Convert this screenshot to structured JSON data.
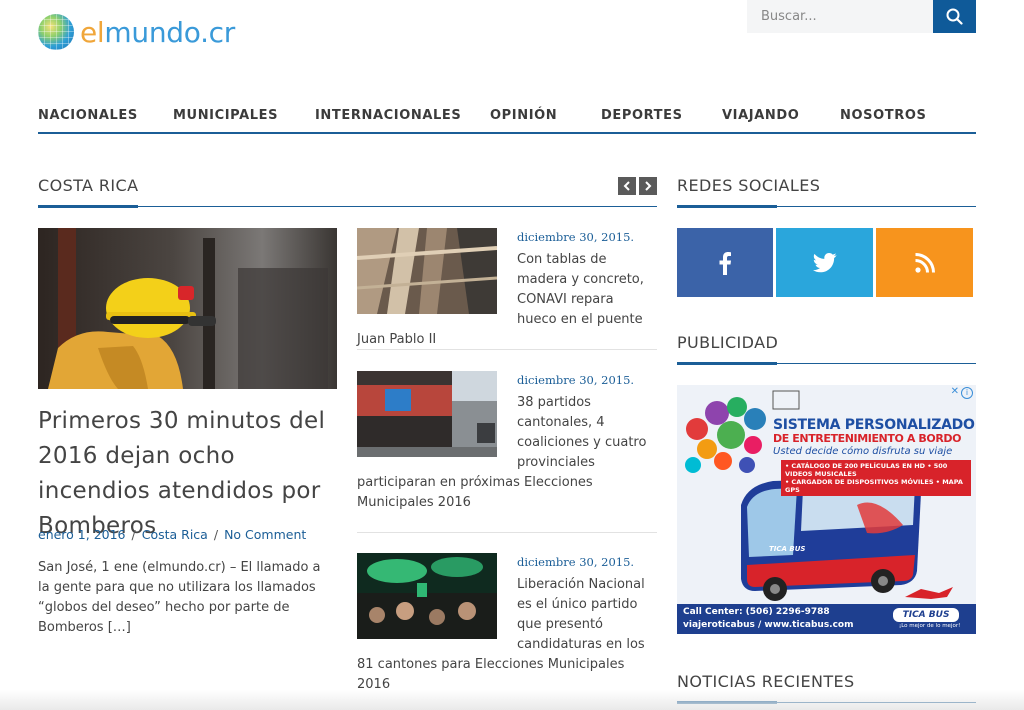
{
  "site": {
    "logo_el": "el",
    "logo_rest": "mundo.cr"
  },
  "search": {
    "placeholder": "Buscar..."
  },
  "nav": {
    "items": [
      "NACIONALES",
      "MUNICIPALES",
      "INTERNACIONALES",
      "OPINIÓN",
      "DEPORTES",
      "VIAJANDO",
      "NOSOTROS"
    ]
  },
  "main": {
    "section_title": "COSTA RICA",
    "featured": {
      "title": "Primeros 30 minutos del 2016 dejan ocho incendios atendidos por Bomberos",
      "date": "enero 1, 2016",
      "category": "Costa Rica",
      "comments": "No Comment",
      "separator": "/",
      "excerpt": "San José, 1 ene (elmundo.cr) – El llamado a la gente para que no utilizara los llamados “globos del deseo” hecho por parte de Bomberos […]"
    },
    "side_articles": [
      {
        "date": "diciembre 30, 2015.",
        "title": "Con tablas de madera y concreto, CONAVI repara hueco en el puente Juan Pablo II"
      },
      {
        "date": "diciembre 30, 2015.",
        "title": "38 partidos cantonales, 4 coaliciones y cuatro provinciales participaran en próximas Elecciones Municipales 2016"
      },
      {
        "date": "diciembre 30, 2015.",
        "title": "Liberación Nacional es el único partido que presentó candidaturas en los 81 cantones para Elecciones Municipales 2016"
      }
    ]
  },
  "sidebar": {
    "social_title": "REDES SOCIALES",
    "ads_title": "PUBLICIDAD",
    "recent_title": "NOTICIAS RECIENTES",
    "social": [
      {
        "name": "facebook",
        "color": "#3b63a8"
      },
      {
        "name": "twitter",
        "color": "#2aa6dc"
      },
      {
        "name": "rss",
        "color": "#f7941d"
      }
    ]
  },
  "ad": {
    "title1": "SISTEMA PERSONALIZADO",
    "title2": "DE ENTRETENIMIENTO A BORDO",
    "subtitle": "Usted decide cómo disfruta su viaje",
    "bullet1": "• CATÁLOGO DE 200 PELÍCULAS EN HD • 500 VIDEOS MUSICALES",
    "bullet2": "• CARGADOR DE DISPOSITIVOS MÓVILES • MAPA GPS",
    "call": "Call Center: (506) 2296-9788",
    "web": "viajeroticabus / www.ticabus.com",
    "brand": "TICA BUS",
    "tagline": "¡Lo mejor de lo mejor!",
    "bus_brand": "TICA BUS"
  },
  "colors": {
    "accent": "#1b5e97",
    "search_button": "#0f5a99"
  }
}
